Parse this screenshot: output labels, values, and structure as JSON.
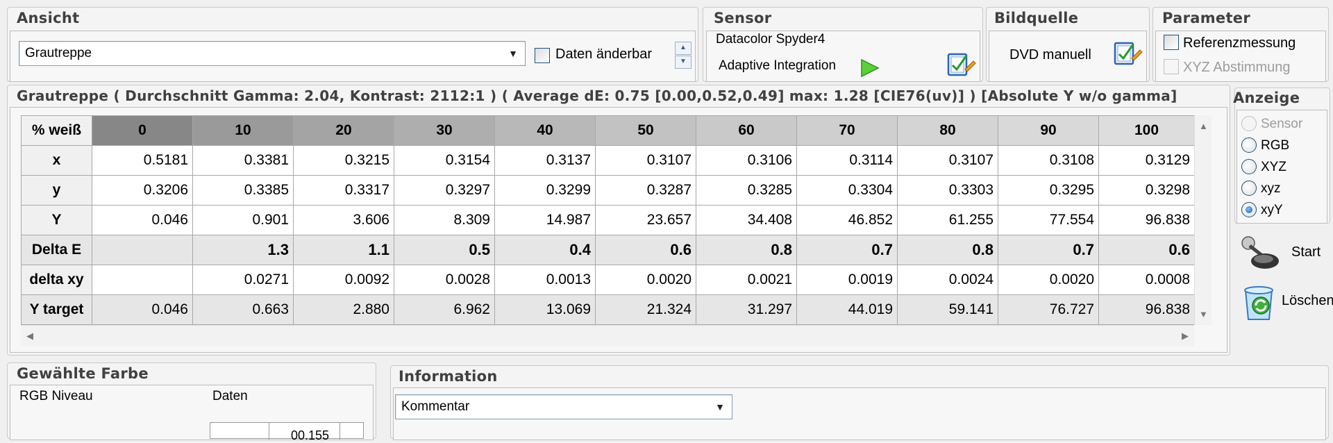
{
  "ansicht": {
    "title": "Ansicht",
    "mode_value": "Grautreppe",
    "editable_label": "Daten änderbar"
  },
  "sensor": {
    "title": "Sensor",
    "device": "Datacolor Spyder4",
    "integration": "Adaptive Integration"
  },
  "bildquelle": {
    "title": "Bildquelle",
    "source": "DVD manuell"
  },
  "parameter": {
    "title": "Parameter",
    "reference_label": "Referenzmessung",
    "xyz_label": "XYZ Abstimmung"
  },
  "summary": {
    "text": "Grautreppe ( Durchschnitt Gamma: 2.04, Kontrast: 2112:1 ) ( Average dE: 0.75 [0.00,0.52,0.49] max: 1.28 [CIE76(uv)] ) [Absolute Y w/o gamma]"
  },
  "anzeige": {
    "title": "Anzeige",
    "options": [
      "Sensor",
      "RGB",
      "XYZ",
      "xyz",
      "xyY"
    ],
    "selected": "xyY"
  },
  "actions": {
    "start_label": "Start",
    "delete_label": "Löschen"
  },
  "table": {
    "corner": "% weiß",
    "columns": [
      "0",
      "10",
      "20",
      "30",
      "40",
      "50",
      "60",
      "70",
      "80",
      "90",
      "100"
    ],
    "column_colors": [
      "#878787",
      "#9a9a9a",
      "#a4a4a4",
      "#aeaeae",
      "#b8b8b8",
      "#c2c2c2",
      "#c9c9c9",
      "#cfcfcf",
      "#d4d4d4",
      "#d9d9d9",
      "#dddddd"
    ],
    "rows": [
      {
        "label": "x",
        "values": [
          "0.5181",
          "0.3381",
          "0.3215",
          "0.3154",
          "0.3137",
          "0.3107",
          "0.3106",
          "0.3114",
          "0.3107",
          "0.3108",
          "0.3129"
        ]
      },
      {
        "label": "y",
        "values": [
          "0.3206",
          "0.3385",
          "0.3317",
          "0.3297",
          "0.3299",
          "0.3287",
          "0.3285",
          "0.3304",
          "0.3303",
          "0.3295",
          "0.3298"
        ]
      },
      {
        "label": "Y",
        "values": [
          "0.046",
          "0.901",
          "3.606",
          "8.309",
          "14.987",
          "23.657",
          "34.408",
          "46.852",
          "61.255",
          "77.554",
          "96.838"
        ]
      },
      {
        "label": "Delta E",
        "values": [
          "",
          "1.3",
          "1.1",
          "0.5",
          "0.4",
          "0.6",
          "0.8",
          "0.7",
          "0.8",
          "0.7",
          "0.6"
        ]
      },
      {
        "label": "delta xy",
        "values": [
          "",
          "0.0271",
          "0.0092",
          "0.0028",
          "0.0013",
          "0.0020",
          "0.0021",
          "0.0019",
          "0.0024",
          "0.0020",
          "0.0008"
        ]
      },
      {
        "label": "Y target",
        "values": [
          "0.046",
          "0.663",
          "2.880",
          "6.962",
          "13.069",
          "21.324",
          "31.297",
          "44.019",
          "59.141",
          "76.727",
          "96.838"
        ]
      }
    ]
  },
  "gewaehlte": {
    "title": "Gewählte Farbe",
    "col1": "RGB Niveau",
    "col2": "Daten",
    "partial_value": "00.155"
  },
  "information": {
    "title": "Information",
    "combo_value": "Kommentar"
  }
}
